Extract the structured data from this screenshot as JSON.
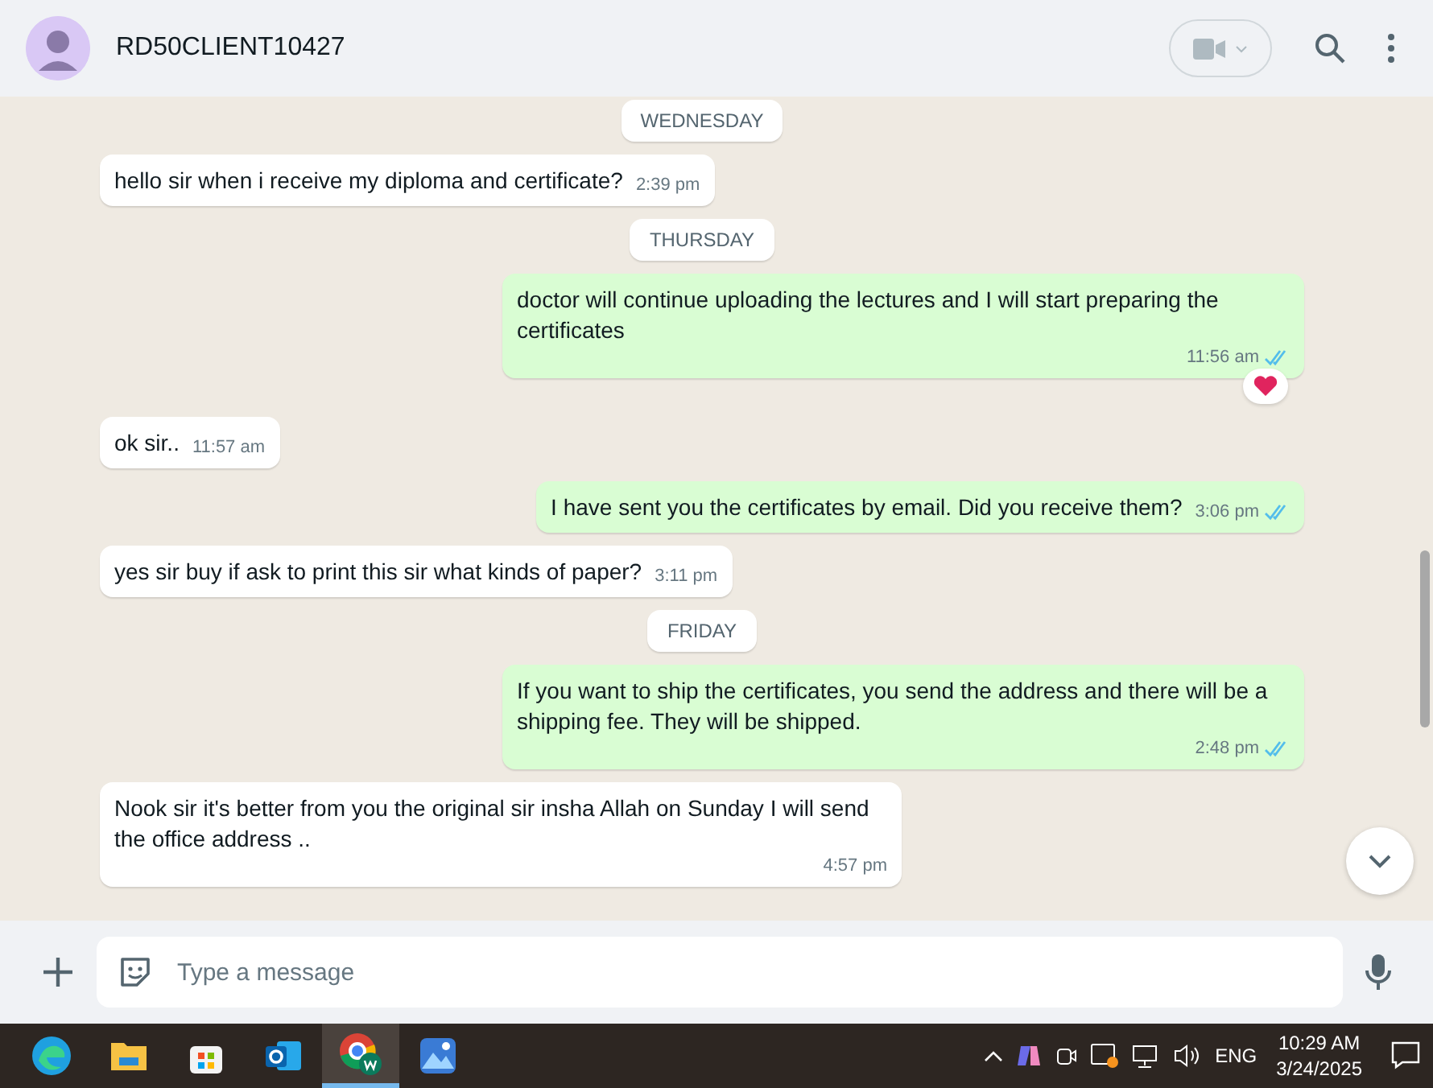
{
  "header": {
    "contact_name": "RD50CLIENT10427"
  },
  "messages": [
    {
      "kind": "date",
      "text": "WEDNESDAY"
    },
    {
      "kind": "in",
      "text": "hello sir when i receive my diploma and certificate?",
      "time": "2:39 pm"
    },
    {
      "kind": "date",
      "text": "THURSDAY"
    },
    {
      "kind": "out",
      "text": "doctor will continue uploading the lectures and I will start preparing the certificates",
      "time": "11:56 am",
      "read": true,
      "reacted": true
    },
    {
      "kind": "in",
      "text": "ok sir..",
      "time": "11:57 am"
    },
    {
      "kind": "out",
      "text": "I have sent you the certificates by email. Did you receive them?",
      "time": "3:06 pm",
      "read": true,
      "reacted": false
    },
    {
      "kind": "in",
      "text": "yes sir buy if ask to print this sir what kinds of paper?",
      "time": "3:11 pm"
    },
    {
      "kind": "date",
      "text": "FRIDAY"
    },
    {
      "kind": "out",
      "text": "If you want to ship the certificates, you send the address and there will be a shipping fee. They will be shipped.",
      "time": "2:48 pm",
      "read": true,
      "reacted": false
    },
    {
      "kind": "in",
      "text": "Nook sir it's better from you the original sir insha Allah on Sunday I will send the office address ..",
      "time": "4:57 pm"
    }
  ],
  "composer": {
    "placeholder": "Type a message"
  },
  "taskbar": {
    "apps": [
      {
        "kind": "edge",
        "selected": false
      },
      {
        "kind": "files",
        "selected": false
      },
      {
        "kind": "store",
        "selected": false
      },
      {
        "kind": "outlook",
        "selected": false
      },
      {
        "kind": "chrome",
        "selected": true
      },
      {
        "kind": "photos",
        "selected": false
      }
    ],
    "language": "ENG",
    "time": "10:29 AM",
    "date": "3/24/2025"
  }
}
